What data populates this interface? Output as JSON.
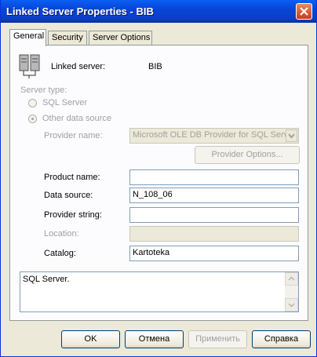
{
  "window": {
    "title": "Linked Server Properties - BIB",
    "close_icon": "close-icon"
  },
  "tabs": [
    {
      "label": "General",
      "active": true
    },
    {
      "label": "Security",
      "active": false
    },
    {
      "label": "Server Options",
      "active": false
    }
  ],
  "general": {
    "linked_server_label": "Linked server:",
    "linked_server_value": "BIB",
    "server_type_label": "Server type:",
    "sql_server_option": "SQL Server",
    "other_source_option": "Other data source",
    "provider_name_label": "Provider name:",
    "provider_name_value": "Microsoft OLE DB Provider for SQL Server",
    "provider_options_button": "Provider Options...",
    "product_name_label": "Product name:",
    "product_name_value": "",
    "data_source_label": "Data source:",
    "data_source_value": "N_108_06",
    "provider_string_label": "Provider string:",
    "provider_string_value": "",
    "location_label": "Location:",
    "location_value": "",
    "catalog_label": "Catalog:",
    "catalog_value": "Kartoteka",
    "description_text": "SQL Server."
  },
  "footer": {
    "ok": "OK",
    "cancel": "Отмена",
    "apply": "Применить",
    "help": "Справка"
  },
  "colors": {
    "titlebar": "#0845d8",
    "close_button": "#d55a32",
    "window_bg": "#ece9d8",
    "panel_bg": "#fcfcfe",
    "disabled_text": "#a0a0a0"
  }
}
